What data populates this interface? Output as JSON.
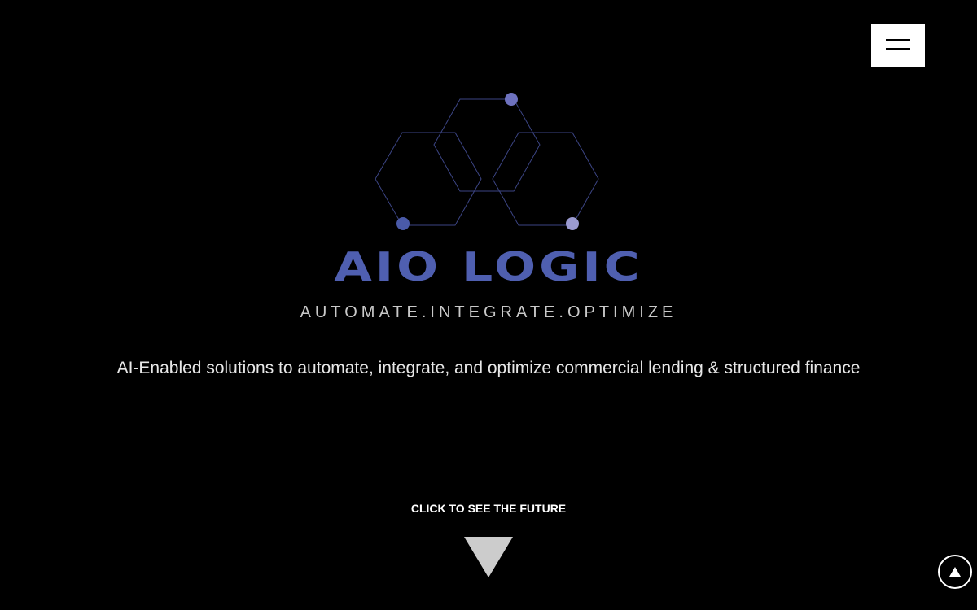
{
  "brand": {
    "name_part1": "AIO",
    "name_part2": "LOGIC",
    "tagline": "AUTOMATE.INTEGRATE.OPTIMIZE",
    "accent_color": "#4f5fb0"
  },
  "hero": {
    "description": "AI-Enabled solutions to automate, integrate, and optimize commercial lending & structured finance",
    "cta_label": "CLICK TO SEE THE FUTURE"
  },
  "icons": {
    "menu": "hamburger-menu-icon",
    "cta": "down-triangle-icon",
    "scroll_top": "up-triangle-icon",
    "logo": "hexagon-network-logo"
  },
  "colors": {
    "background": "#000000",
    "text": "#ffffff",
    "tagline": "#c9c9c9",
    "arrow": "#cccccc"
  }
}
